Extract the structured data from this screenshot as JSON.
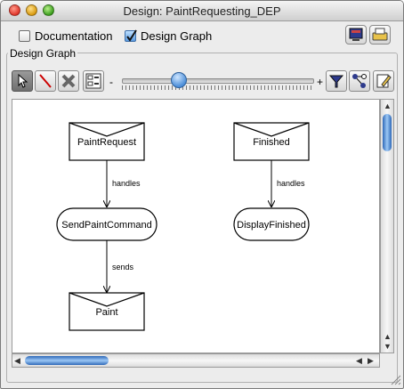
{
  "window": {
    "title": "Design: PaintRequesting_DEP"
  },
  "options": {
    "documentation": {
      "label": "Documentation",
      "checked": false
    },
    "design_graph": {
      "label": "Design Graph",
      "checked": true
    }
  },
  "group": {
    "label": "Design Graph"
  },
  "toolbar": {
    "tools": [
      "select-arrow-icon",
      "draw-line-icon",
      "delete-x-icon",
      "layout-icon"
    ],
    "zoom_minus": "-",
    "zoom_plus": "+",
    "zoom_level": 0.3,
    "right_tools": [
      "filter-funnel-icon",
      "graph-nodes-icon",
      "edit-pencil-icon"
    ]
  },
  "graph": {
    "nodes": {
      "paint_request": "PaintRequest",
      "send_paint_command": "SendPaintCommand",
      "paint": "Paint",
      "finished": "Finished",
      "display_finished": "DisplayFinished"
    },
    "edges": {
      "handles_1": "handles",
      "sends": "sends",
      "handles_2": "handles"
    }
  },
  "colors": {
    "accent": "#3a78c9",
    "canvas": "#ffffff",
    "window": "#ececec"
  }
}
